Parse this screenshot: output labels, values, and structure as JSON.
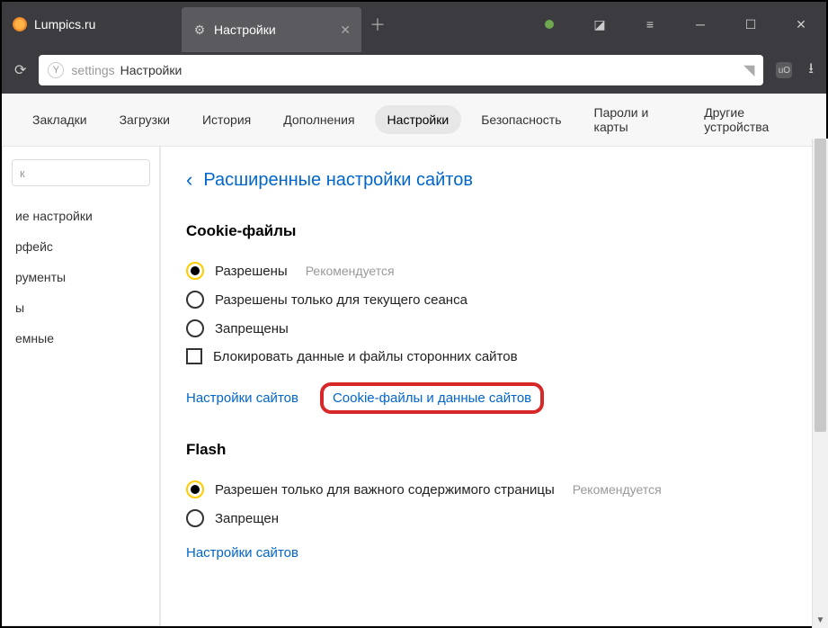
{
  "titlebar": {
    "tabs": [
      {
        "label": "Lumpics.ru",
        "active": false
      },
      {
        "label": "Настройки",
        "active": true
      }
    ]
  },
  "addressbar": {
    "prefix": "settings",
    "path": "Настройки"
  },
  "nav_tabs": {
    "items": [
      "Закладки",
      "Загрузки",
      "История",
      "Дополнения",
      "Настройки",
      "Безопасность",
      "Пароли и карты",
      "Другие устройства"
    ],
    "active_index": 4
  },
  "sidebar": {
    "search_placeholder": "к",
    "items": [
      "ие настройки",
      "рфейс",
      "рументы",
      "ы",
      "емные"
    ]
  },
  "page": {
    "header": "Расширенные настройки сайтов",
    "sections": [
      {
        "title": "Cookie-файлы",
        "options": [
          {
            "type": "radio",
            "label": "Разрешены",
            "hint": "Рекомендуется",
            "selected": true
          },
          {
            "type": "radio",
            "label": "Разрешены только для текущего сеанса",
            "selected": false
          },
          {
            "type": "radio",
            "label": "Запрещены",
            "selected": false
          },
          {
            "type": "checkbox",
            "label": "Блокировать данные и файлы сторонних сайтов",
            "selected": false
          }
        ],
        "links": [
          {
            "label": "Настройки сайтов",
            "highlighted": false
          },
          {
            "label": "Cookie-файлы и данные сайтов",
            "highlighted": true
          }
        ]
      },
      {
        "title": "Flash",
        "options": [
          {
            "type": "radio",
            "label": "Разрешен только для важного содержимого страницы",
            "hint": "Рекомендуется",
            "selected": true
          },
          {
            "type": "radio",
            "label": "Запрещен",
            "selected": false
          }
        ],
        "links": [
          {
            "label": "Настройки сайтов",
            "highlighted": false
          }
        ]
      }
    ]
  }
}
